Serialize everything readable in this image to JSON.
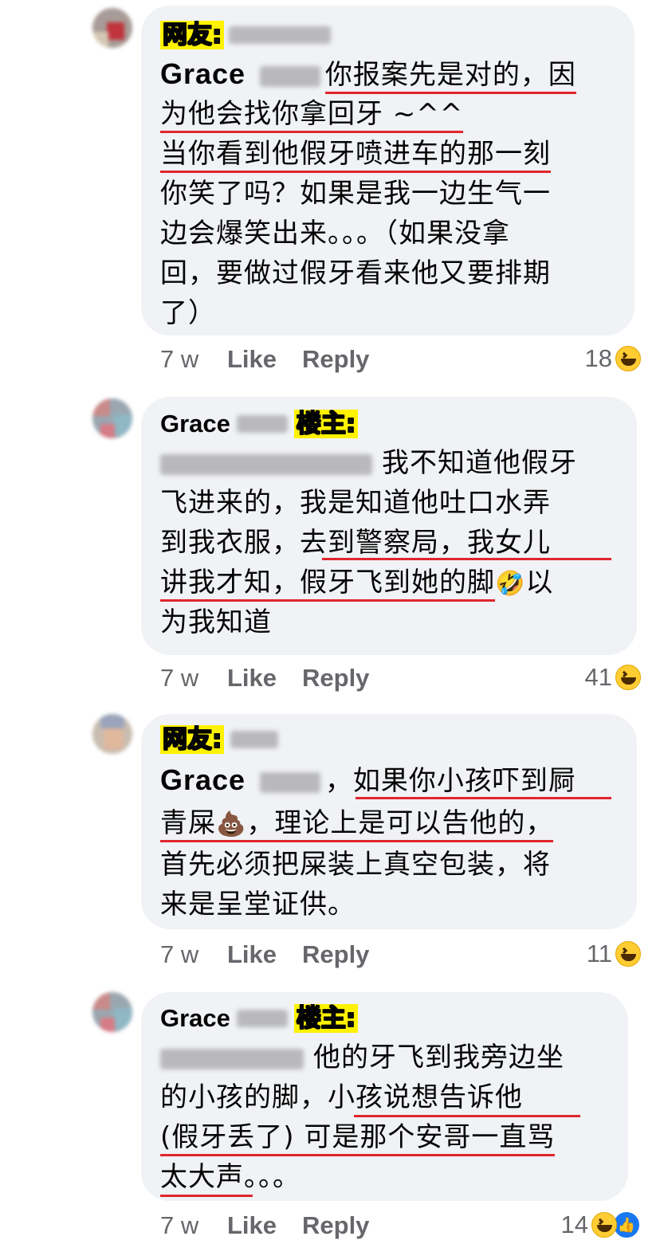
{
  "comments": [
    {
      "tag": "网友:",
      "lines": [
        "你报案先是对的，因",
        "为他会找你拿回牙 ~^^",
        "当你看到他假牙喷进车的那一刻",
        "你笑了吗？如果是我一边生气一",
        "边会爆笑出来。。。（如果没拿",
        "回，要做过假牙看来他又要排期",
        "了）"
      ],
      "mention": "Grace",
      "time": "7 w",
      "like": "Like",
      "reply": "Reply",
      "count": "18"
    },
    {
      "mention": "Grace",
      "tag": "楼主:",
      "lines": [
        "我不知道他假牙",
        "飞进来的，我是知道他吐口水弄",
        "到我衣服，去到警察局，我女儿",
        "讲我才知，假牙飞到她的脚",
        "以",
        "为我知道"
      ],
      "emoji": "🤣",
      "time": "7 w",
      "like": "Like",
      "reply": "Reply",
      "count": "41"
    },
    {
      "tag": "网友:",
      "mention": "Grace",
      "lines": [
        "，如果你小孩吓到屙",
        "青屎",
        "，理论上是可以告他的，",
        "首先必须把屎装上真空包装，将",
        "来是呈堂证供。"
      ],
      "emoji": "💩",
      "time": "7 w",
      "like": "Like",
      "reply": "Reply",
      "count": "11"
    },
    {
      "mention": "Grace",
      "tag": "楼主:",
      "lines": [
        "他的牙飞到我旁边坐",
        "的小孩的脚，小孩说想告诉他",
        "(假牙丢了) 可是那个安哥一直骂",
        "太大声。。。"
      ],
      "time": "7 w",
      "like": "Like",
      "reply": "Reply",
      "count": "14"
    }
  ],
  "icons": {
    "haha": "haha-react-icon",
    "like": "like-react-icon"
  },
  "colors": {
    "bubble": "#f0f2f5",
    "underline": "#e0262d",
    "tag_bg": "#fff200",
    "meta": "#65676b",
    "like_blue": "#1877f2"
  }
}
